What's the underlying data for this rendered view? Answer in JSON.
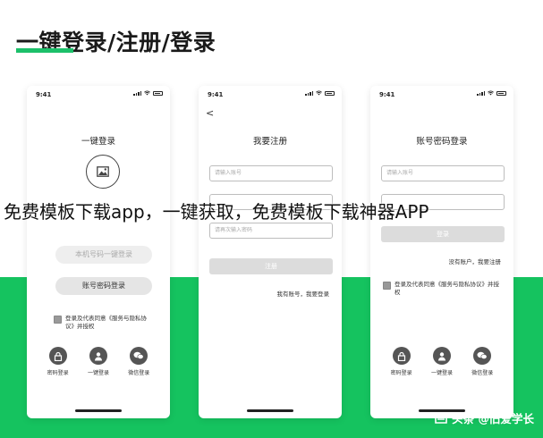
{
  "header": {
    "title": "一键登录/注册/登录"
  },
  "phones": [
    {
      "time": "9:41",
      "title": "一键登录",
      "btn_number": "本机号码一键登录",
      "btn_account": "账号密码登录",
      "agreement": "登录及代表同意《服务与隐私协议》并授权",
      "options": [
        {
          "label": "密码登录"
        },
        {
          "label": "一键登录"
        },
        {
          "label": "微信登录"
        }
      ]
    },
    {
      "time": "9:41",
      "back": "<",
      "title": "我要注册",
      "field1_placeholder": "请输入账号",
      "field3_placeholder": "请再次输入密码",
      "btn_register": "注册",
      "link_have_account": "我有账号，我要登录"
    },
    {
      "time": "9:41",
      "title": "账号密码登录",
      "field1_placeholder": "请输入账号",
      "btn_login": "登录",
      "link_register": "没有账户，我要注册",
      "agreement": "登录及代表同意《服务与隐私协议》并授权",
      "options": [
        {
          "label": "密码登录"
        },
        {
          "label": "一键登录"
        },
        {
          "label": "微信登录"
        }
      ]
    }
  ],
  "overlay_caption": "免费模板下载app，一键获取，免费模板下载神器APP",
  "footer_watermark": "头条 @旧爱学长",
  "colors": {
    "accent_green": "#15c35f",
    "header_underline": "#1cc06a"
  }
}
